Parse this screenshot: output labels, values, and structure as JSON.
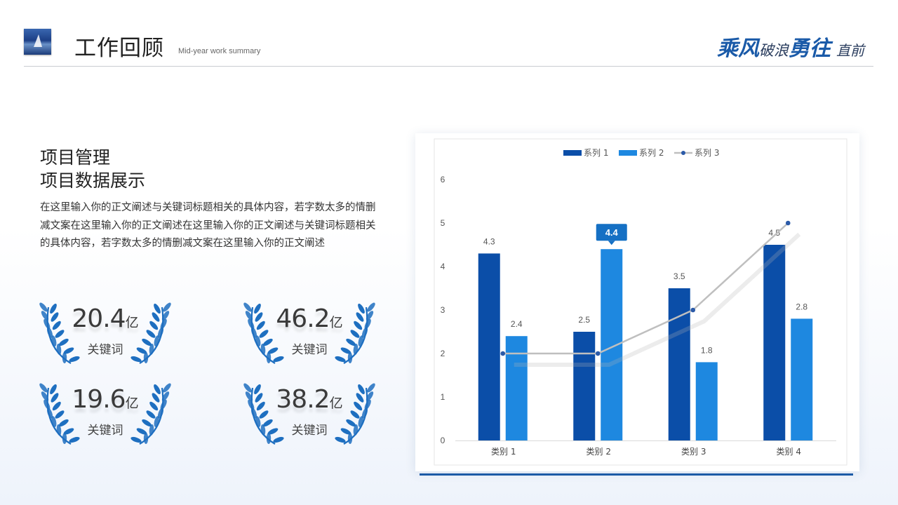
{
  "header": {
    "title": "工作回顾",
    "subtitle": "Mid-year work summary",
    "slogan": {
      "part1": "乘风",
      "part2": "破浪",
      "part3": "勇往",
      "part4": "直前"
    }
  },
  "section": {
    "title_line1": "项目管理",
    "title_line2": "项目数据展示",
    "body": "在这里输入你的正文阐述与关键词标题相关的具体内容，若字数太多的情删减文案在这里输入你的正文阐述在这里输入你的正文阐述与关键词标题相关的具体内容，若字数太多的情删减文案在这里输入你的正文阐述"
  },
  "stats": [
    {
      "value": "20.4",
      "unit": "亿",
      "label": "关键词"
    },
    {
      "value": "46.2",
      "unit": "亿",
      "label": "关键词"
    },
    {
      "value": "19.6",
      "unit": "亿",
      "label": "关键词"
    },
    {
      "value": "38.2",
      "unit": "亿",
      "label": "关键词"
    }
  ],
  "colors": {
    "series1": "#0b4ea8",
    "series2": "#1e88e0",
    "series3": "#bfbfbf",
    "series3_marker": "#2b5aa8",
    "laurel": "#1e6fc0",
    "callout": "#1570c4"
  },
  "chart_data": {
    "type": "bar",
    "categories": [
      "类别 1",
      "类别 2",
      "类别 3",
      "类别 4"
    ],
    "series": [
      {
        "name": "系列 1",
        "type": "bar",
        "values": [
          4.3,
          2.5,
          3.5,
          4.5
        ]
      },
      {
        "name": "系列 2",
        "type": "bar",
        "values": [
          2.4,
          4.4,
          1.8,
          2.8
        ]
      },
      {
        "name": "系列 3",
        "type": "line",
        "values": [
          2.0,
          2.0,
          3.0,
          5.0
        ]
      }
    ],
    "value_labels_shown": {
      "系列 1": true,
      "系列 2": true,
      "系列 3": false
    },
    "highlighted": {
      "series": "系列 2",
      "category": "类别 2",
      "value": "4.4"
    },
    "ylim": [
      0,
      6
    ],
    "yticks": [
      0,
      1,
      2,
      3,
      4,
      5,
      6
    ],
    "legend": "top-center",
    "grid": false,
    "xlabel": "",
    "ylabel": ""
  }
}
